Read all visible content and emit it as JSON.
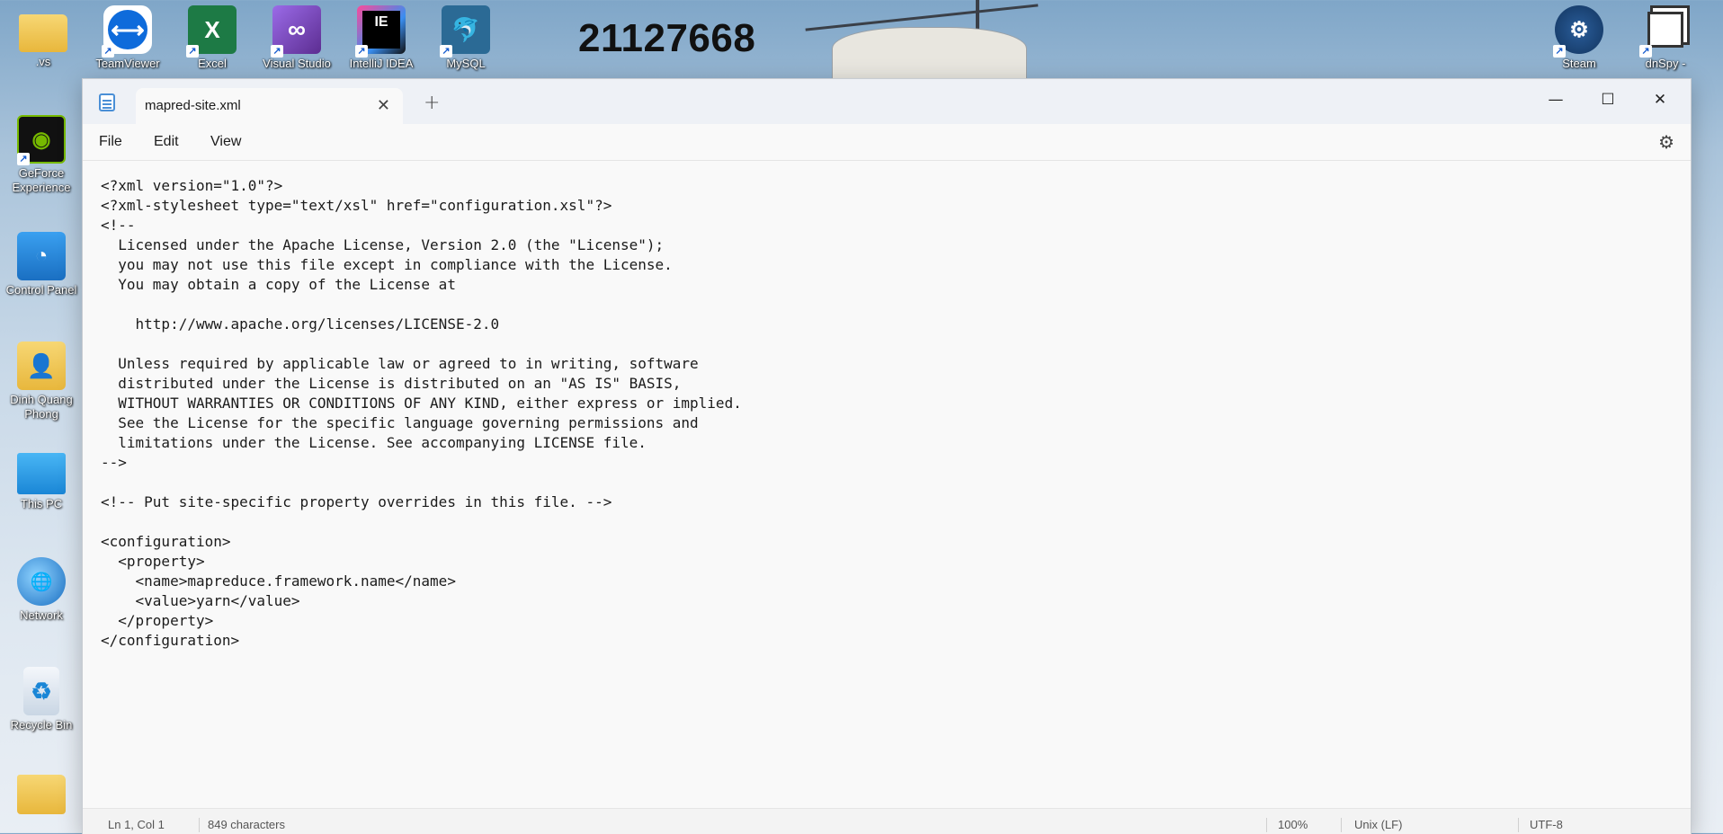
{
  "desktop": {
    "number_label": "21127668",
    "icons_top": [
      {
        "label": ".vs",
        "icon": "folder-icon"
      },
      {
        "label": "TeamViewer",
        "icon": "teamviewer-icon"
      },
      {
        "label": "Excel",
        "icon": "excel-icon"
      },
      {
        "label": "Visual Studio",
        "icon": "visual-studio-icon"
      },
      {
        "label": "IntelliJ IDEA",
        "icon": "intellij-icon"
      },
      {
        "label": "MySQL",
        "icon": "mysql-icon"
      },
      {
        "label": "Steam",
        "icon": "steam-icon"
      },
      {
        "label": "dnSpy -",
        "icon": "dnspy-icon"
      }
    ],
    "icons_left": [
      {
        "label": "GeForce Experience",
        "icon": "geforce-icon"
      },
      {
        "label": "Control Panel",
        "icon": "control-panel-icon"
      },
      {
        "label": "Dinh Quang Phong",
        "icon": "user-folder-icon"
      },
      {
        "label": "This PC",
        "icon": "this-pc-icon"
      },
      {
        "label": "Network",
        "icon": "network-icon"
      },
      {
        "label": "Recycle Bin",
        "icon": "recycle-bin-icon"
      },
      {
        "label": "",
        "icon": "folder-icon"
      }
    ]
  },
  "window": {
    "tab_title": "mapred-site.xml",
    "tab_add": "+",
    "controls": {
      "minimize": "—",
      "maximize": "☐",
      "close": "✕"
    },
    "menu": [
      "File",
      "Edit",
      "View"
    ]
  },
  "editor": {
    "content": "<?xml version=\"1.0\"?>\n<?xml-stylesheet type=\"text/xsl\" href=\"configuration.xsl\"?>\n<!--\n  Licensed under the Apache License, Version 2.0 (the \"License\");\n  you may not use this file except in compliance with the License.\n  You may obtain a copy of the License at\n\n    http://www.apache.org/licenses/LICENSE-2.0\n\n  Unless required by applicable law or agreed to in writing, software\n  distributed under the License is distributed on an \"AS IS\" BASIS,\n  WITHOUT WARRANTIES OR CONDITIONS OF ANY KIND, either express or implied.\n  See the License for the specific language governing permissions and\n  limitations under the License. See accompanying LICENSE file.\n-->\n\n<!-- Put site-specific property overrides in this file. -->\n\n<configuration>\n  <property>\n    <name>mapreduce.framework.name</name>\n    <value>yarn</value>\n  </property>\n</configuration>"
  },
  "status": {
    "position": "Ln 1, Col 1",
    "characters": "849 characters",
    "zoom": "100%",
    "line_ending": "Unix (LF)",
    "encoding": "UTF-8"
  }
}
